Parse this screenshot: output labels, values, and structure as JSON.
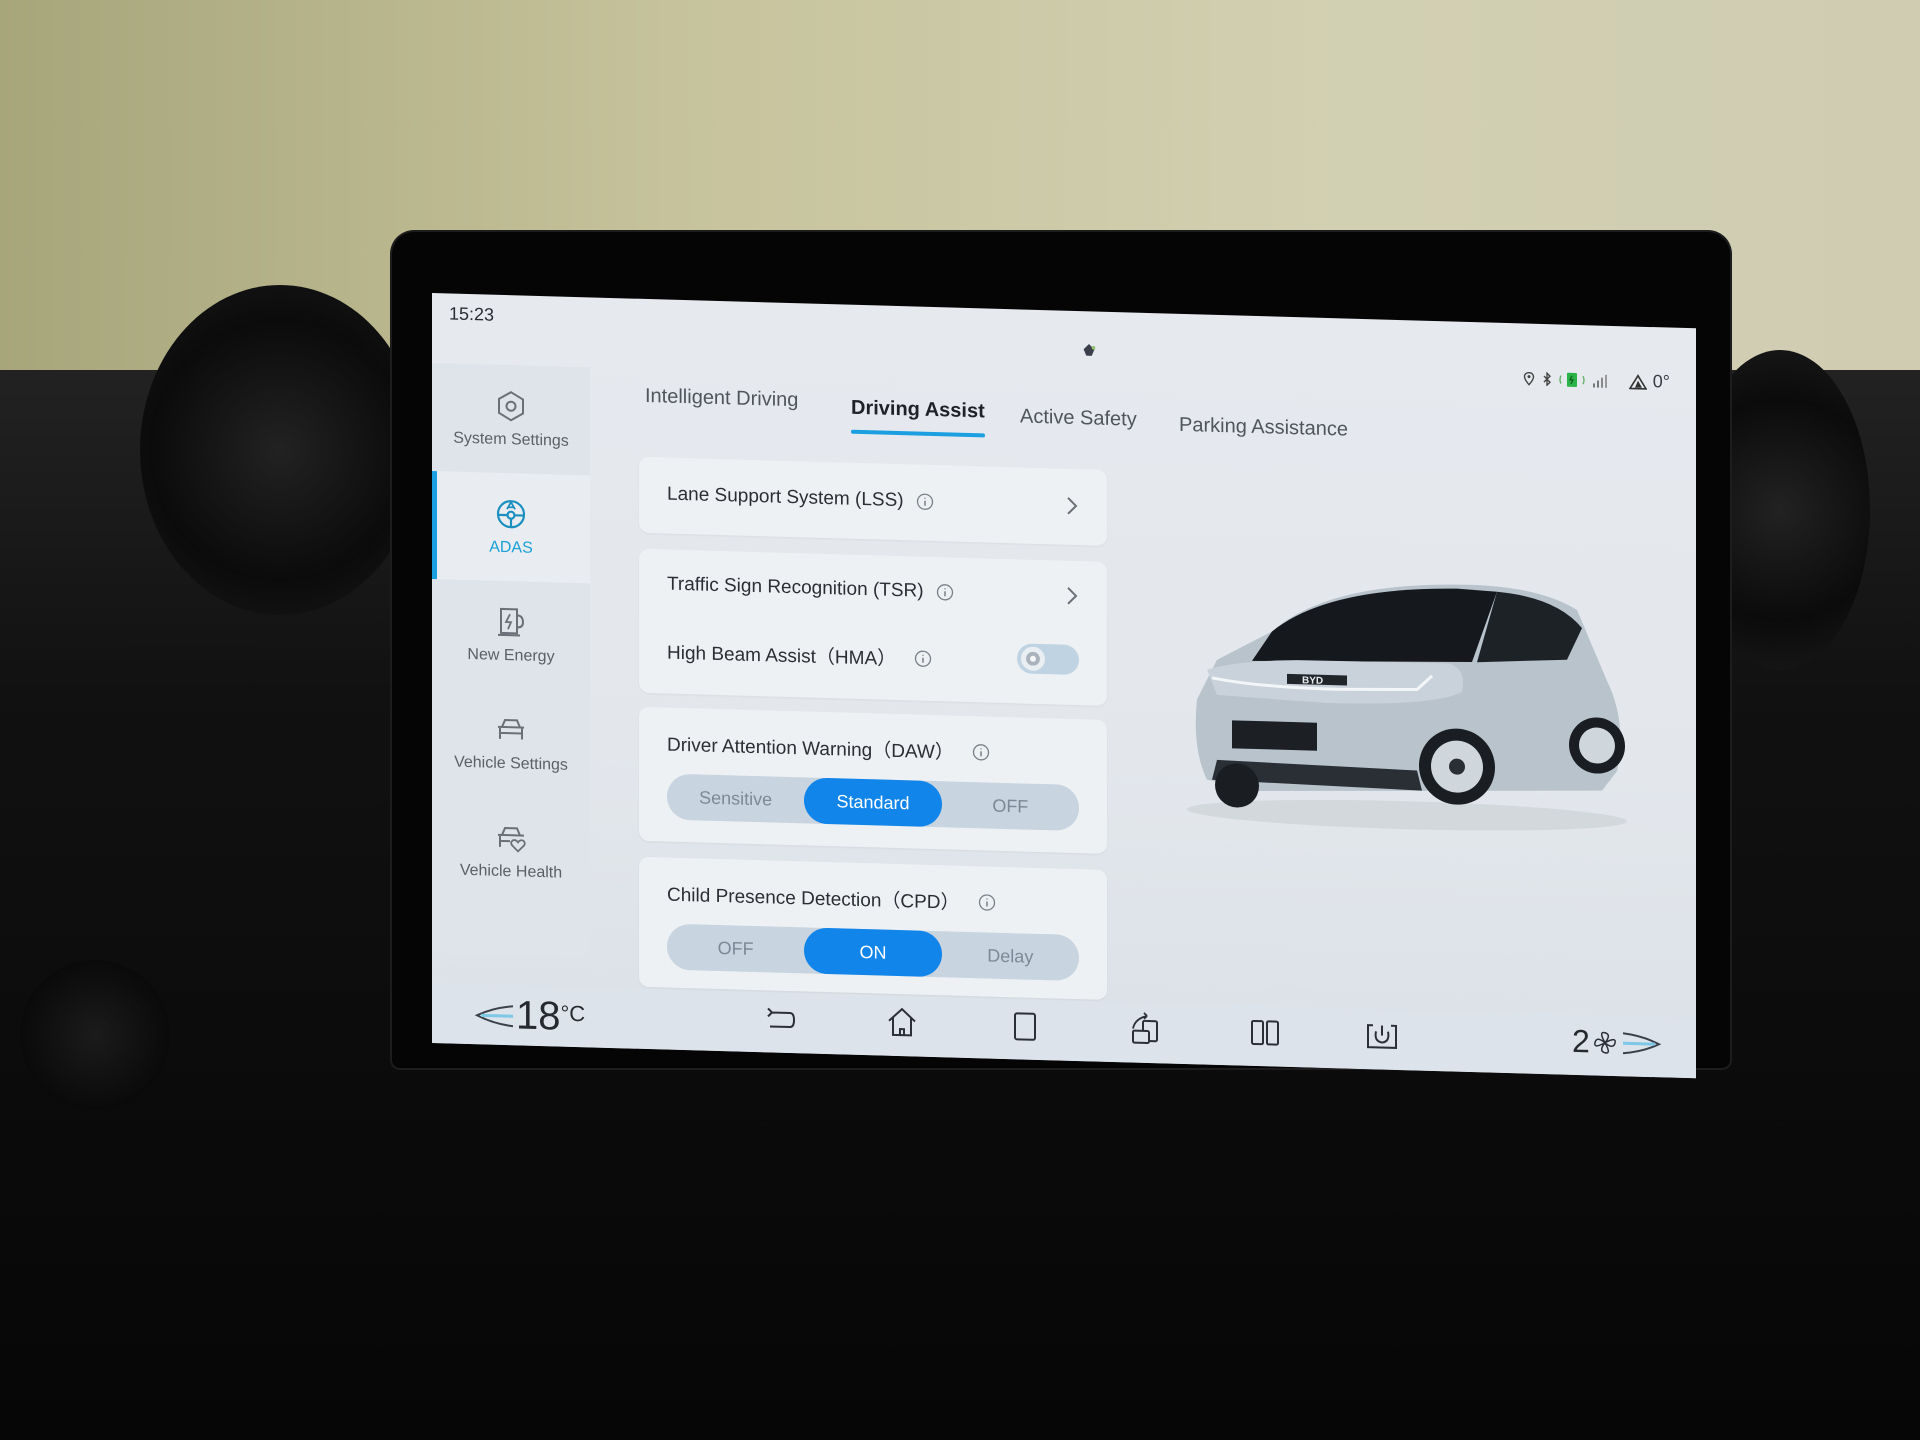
{
  "status_bar": {
    "time": "15:23",
    "icons": [
      "location-icon",
      "bluetooth-icon",
      "phone-charging-icon",
      "signal-icon",
      "weather-warning-icon"
    ],
    "charging_color": "#2bb34a",
    "outside_temp": "0°"
  },
  "sidebar": {
    "active_color": "#1aa0d8",
    "items": [
      {
        "label": "System Settings",
        "icon": "hexagon-gear-icon",
        "active": false
      },
      {
        "label": "ADAS",
        "icon": "steering-wheel-icon",
        "active": true
      },
      {
        "label": "New Energy",
        "icon": "charging-station-icon",
        "active": false
      },
      {
        "label": "Vehicle Settings",
        "icon": "car-icon",
        "active": false
      },
      {
        "label": "Vehicle Health",
        "icon": "car-heart-icon",
        "active": false
      }
    ]
  },
  "tabs": [
    {
      "label": "Intelligent Driving",
      "active": false
    },
    {
      "label": "Driving Assist",
      "active": true
    },
    {
      "label": "Active Safety",
      "active": false
    },
    {
      "label": "Parking Assistance",
      "active": false
    }
  ],
  "settings": {
    "lss": {
      "label": "Lane Support System (LSS)"
    },
    "tsr": {
      "label": "Traffic Sign Recognition (TSR)"
    },
    "hma": {
      "label": "High Beam Assist（HMA）",
      "enabled": false
    },
    "daw": {
      "label": "Driver Attention Warning（DAW）",
      "options": [
        "Sensitive",
        "Standard",
        "OFF"
      ],
      "selected": "Standard"
    },
    "cpd": {
      "label": "Child Presence Detection（CPD）",
      "options": [
        "OFF",
        "ON",
        "Delay"
      ],
      "selected": "ON"
    }
  },
  "vehicle_image": {
    "brand_badge": "BYD",
    "description": "silver hatchback car render"
  },
  "bottom_bar": {
    "driver_temp": "18",
    "temp_unit": "°C",
    "fan_level": "2",
    "nav_icons": [
      "back-icon",
      "home-icon",
      "recent-apps-icon",
      "rotate-screen-icon",
      "split-screen-icon",
      "power-screen-icon"
    ]
  },
  "accent_color": "#1285ea"
}
